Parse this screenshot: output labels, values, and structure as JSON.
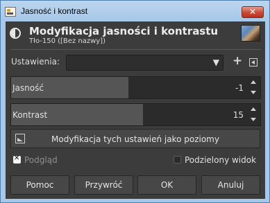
{
  "window": {
    "title": "Jasność i kontrast",
    "close_label": "✕"
  },
  "header": {
    "title": "Modyfikacja jasności i kontrastu",
    "subtitle": "Tło-150 ([Bez nazwy])"
  },
  "settings": {
    "label": "Ustawienia:",
    "value": ""
  },
  "sliders": [
    {
      "label": "Jasność",
      "value": "-1",
      "fill_fraction": 0.5
    },
    {
      "label": "Kontrast",
      "value": "15",
      "fill_fraction": 0.55
    }
  ],
  "levels_button": {
    "label": "Modyfikacja tych ustawień jako poziomy"
  },
  "options": {
    "preview": {
      "label": "Podgląd",
      "checked": true
    },
    "split_view": {
      "label": "Podzielony widok",
      "checked": false
    }
  },
  "buttons": {
    "help": "Pomoc",
    "reset": "Przywróć",
    "ok": "OK",
    "cancel": "Anuluj"
  }
}
